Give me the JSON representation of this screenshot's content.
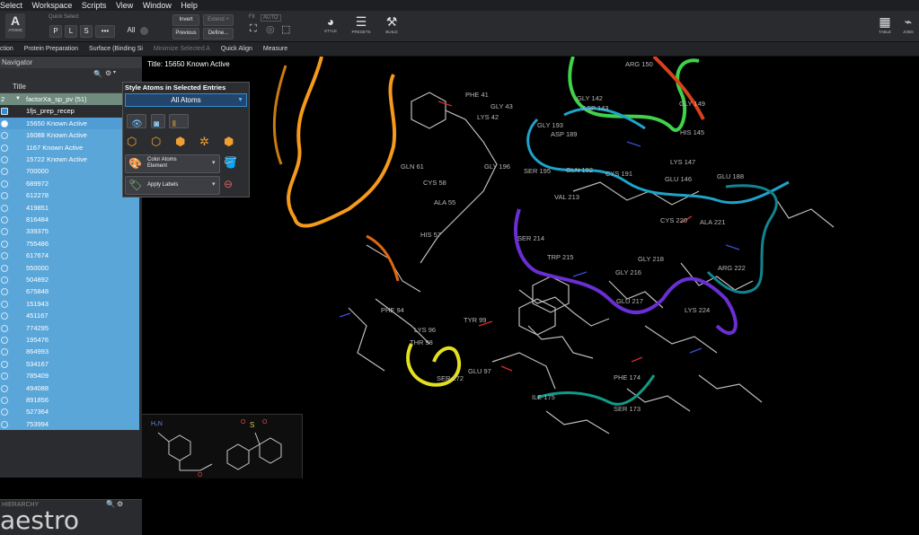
{
  "menu": [
    "Select",
    "Workspace",
    "Scripts",
    "View",
    "Window",
    "Help"
  ],
  "toolbar": {
    "atoms_label": "ATOMS",
    "quick_select_label": "Quick Select",
    "p_label": "P",
    "l_label": "L",
    "s_label": "S",
    "more_label": "•••",
    "all_label": "All",
    "invert_label": "Invert",
    "extend_label": "Extend +",
    "previous_label": "Previous",
    "define_label": "Define...",
    "fit_label": "Fit",
    "auto_label": "AUTO",
    "style_label": "STYLE",
    "presets_label": "PRESETS",
    "build_label": "BUILD",
    "table_label": "TABLE",
    "jobs_label": "JOBS"
  },
  "tasks": [
    "ction",
    "Protein Preparation",
    "Surface (Binding Si",
    "Minimize Selected A",
    "Quick Align",
    "Measure"
  ],
  "navigator": {
    "title": "Navigator",
    "column_title": "Title",
    "group_num": "2",
    "group_name": "factorXa_sp_pv (51)",
    "entries": [
      "1fjs_prep_recep",
      "15650 Known Active",
      "16088 Known Active",
      "1167 Known Active",
      "15722 Known Active",
      "700000",
      "689972",
      "612278",
      "419851",
      "816484",
      "339375",
      "755486",
      "617674",
      "550000",
      "504892",
      "675848",
      "151943",
      "451167",
      "774295",
      "195476",
      "864993",
      "534167",
      "785409",
      "494088",
      "891856",
      "527364",
      "753994"
    ]
  },
  "hierarchy_label": "HIERARCHY",
  "brand_text": "aestro",
  "viewport": {
    "title": "Title: 15650 Known Active",
    "residues": [
      "ARG 150",
      "PHE 41",
      "GLY 43",
      "GLY 142",
      "GLY 149",
      "LYS 42",
      "ASP 143",
      "GLY 193",
      "ASP 189",
      "HIS 145",
      "GLN 61",
      "GLY 196",
      "SER 195",
      "GLN 192",
      "CYS 191",
      "LYS 147",
      "CYS 58",
      "GLU 146",
      "GLU 188",
      "VAL 213",
      "ALA 55",
      "HIS 57",
      "CYS 220",
      "ALA 221",
      "SER 214",
      "TRP 215",
      "GLY 218",
      "GLY 216",
      "ARG 222",
      "GLU 217",
      "PHE 94",
      "TYR 99",
      "LYS 224",
      "LYS 96",
      "THR 98",
      "GLU 97",
      "SER 172",
      "PHE 174",
      "ILE 175",
      "SER 173"
    ]
  },
  "style_panel": {
    "title": "Style Atoms in Selected Entries",
    "scope": "All Atoms",
    "color_label": "Color Atoms",
    "color_sub": "Element",
    "labels_label": "Apply Labels"
  },
  "colors": {
    "accent": "#2f8fd4",
    "row_selected": "#5aa6d9",
    "row_active": "#4f9dd4",
    "group_row": "#6f8c7f"
  }
}
